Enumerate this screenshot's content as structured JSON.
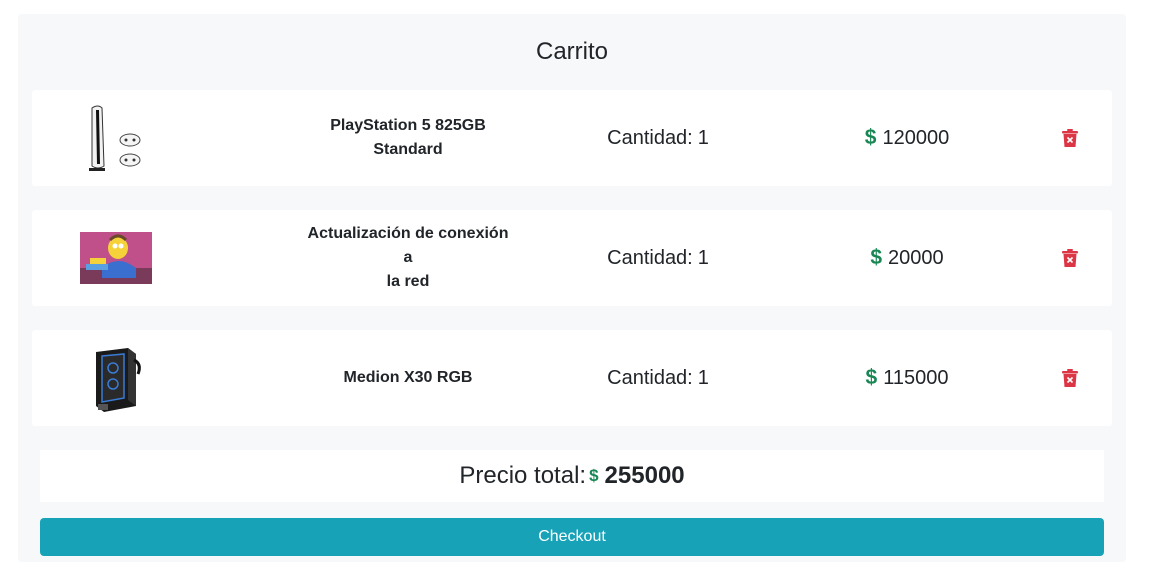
{
  "cart": {
    "title": "Carrito",
    "quantity_label": "Cantidad:",
    "currency_symbol": "$",
    "items": [
      {
        "name_line1": "PlayStation 5 825GB",
        "name_line2": "Standard",
        "quantity": "1",
        "price": "120000",
        "image_icon": "playstation-5-image"
      },
      {
        "name_line1": "Actualización de conexión a",
        "name_line2": "la red",
        "quantity": "1",
        "price": "20000",
        "image_icon": "cartoon-character-image"
      },
      {
        "name_line1": "Medion X30 RGB",
        "name_line2": "",
        "quantity": "1",
        "price": "115000",
        "image_icon": "pc-tower-image"
      }
    ],
    "total_label": "Precio total:",
    "total_value": "255000",
    "checkout_label": "Checkout"
  },
  "colors": {
    "panel_bg": "#f7f8f9",
    "dollar_green": "#198754",
    "delete_red": "#dc3545",
    "checkout_teal": "#17a2b8"
  }
}
